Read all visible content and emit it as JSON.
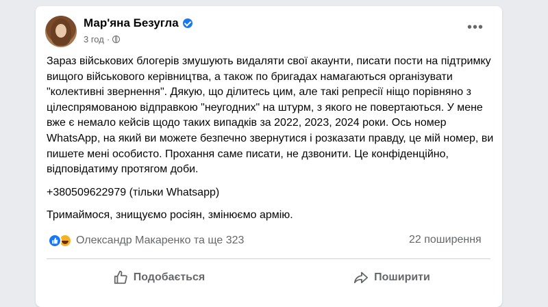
{
  "post": {
    "author": "Мар'яна Безугла",
    "time": "3 год",
    "separator": "·",
    "paragraphs": [
      "Зараз військових блогерів змушують видаляти свої акаунти, писати пости на підтримку вищого військового керівництва, а також по бригадах намагаються організувати \"колективні звернення\". Дякую, що ділитесь цим, але такі репресії ніщо порівняно з цілеспрямованою відправкою \"неугодних\" на штурм, з якого не повертаються. У мене вже є немало кейсів щодо таких випадків за 2022, 2023, 2024 роки. Ось номер WhatsApp, на який ви можете безпечно звернутися і розказати правду, це мій номер, ви пишете мені особисто. Прохання саме писати, не дзвонити. Це конфіденційно, відповідатиму протягом доби.",
      "+380509622979 (тільки Whatsapp)",
      "Тримаймося, знищуємо росіян, змінюємо армію."
    ],
    "reactions_text": "Олександр Макаренко та ще 323",
    "shares_text": "22 поширення",
    "actions": {
      "like_label": "Подобається",
      "share_label": "Поширити"
    }
  },
  "colors": {
    "accent": "#1877f2",
    "secondary_text": "#65676b",
    "background": "#e9ebee"
  }
}
